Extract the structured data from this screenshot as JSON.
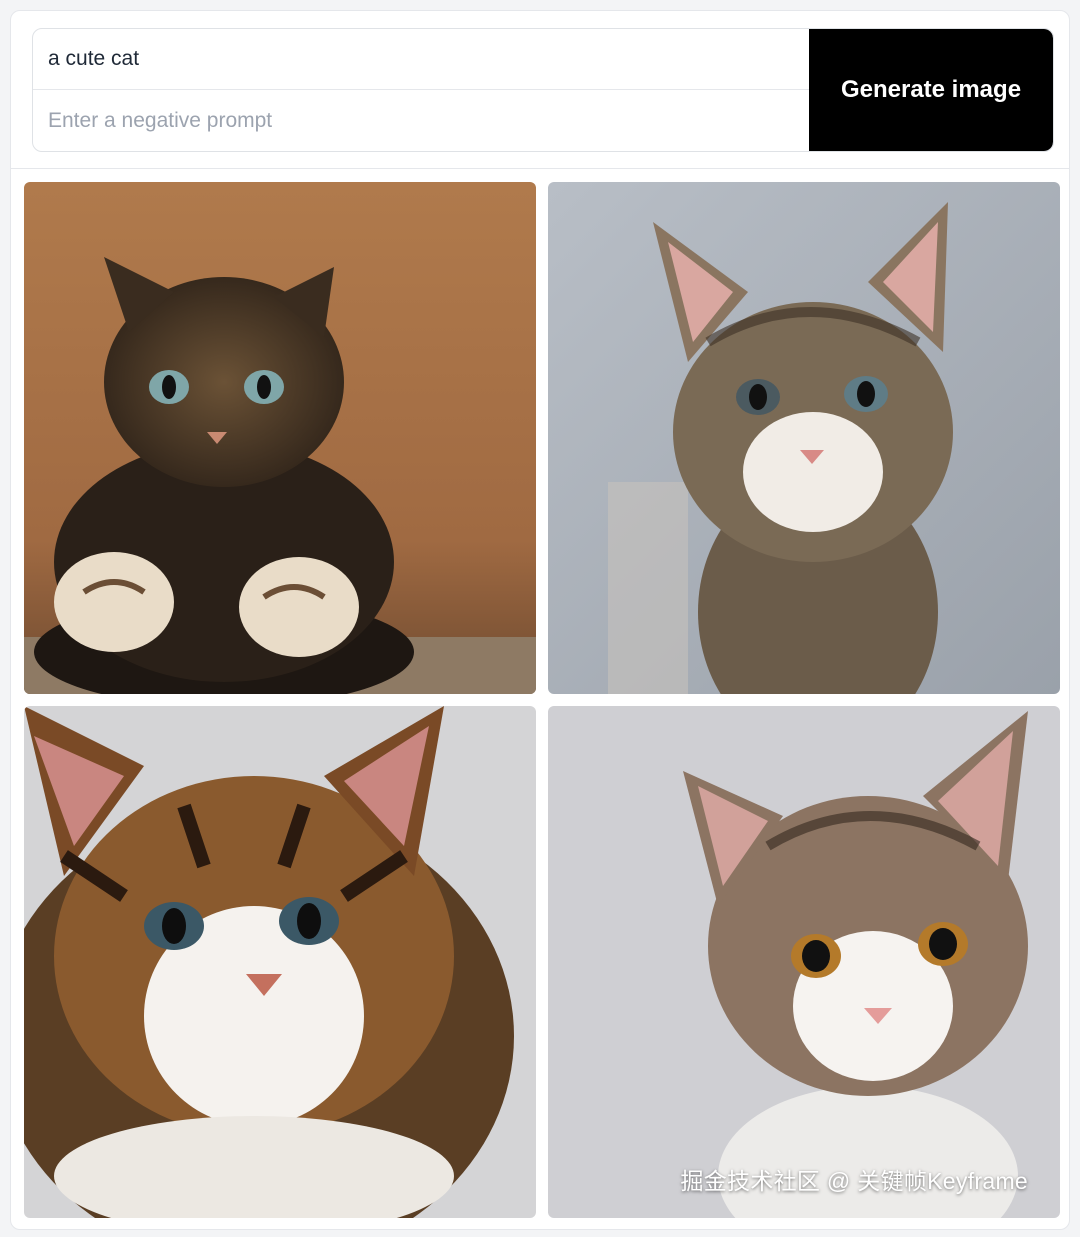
{
  "prompt": {
    "value": "a cute cat",
    "negative_placeholder": "Enter a negative prompt"
  },
  "generate_button": {
    "label": "Generate image"
  },
  "images": [
    {
      "subject": "tabby kitten paws forward",
      "background": "warm brown"
    },
    {
      "subject": "tabby kitten white muzzle",
      "background": "gray-blue"
    },
    {
      "subject": "fluffy tabby kitten close-up",
      "background": "light gray"
    },
    {
      "subject": "tabby kitten amber eyes",
      "background": "light gray"
    }
  ],
  "watermark": "掘金技术社区 @ 关键帧Keyframe",
  "colors": {
    "button_bg": "#000000",
    "button_text": "#ffffff",
    "placeholder": "#9ca3af"
  }
}
